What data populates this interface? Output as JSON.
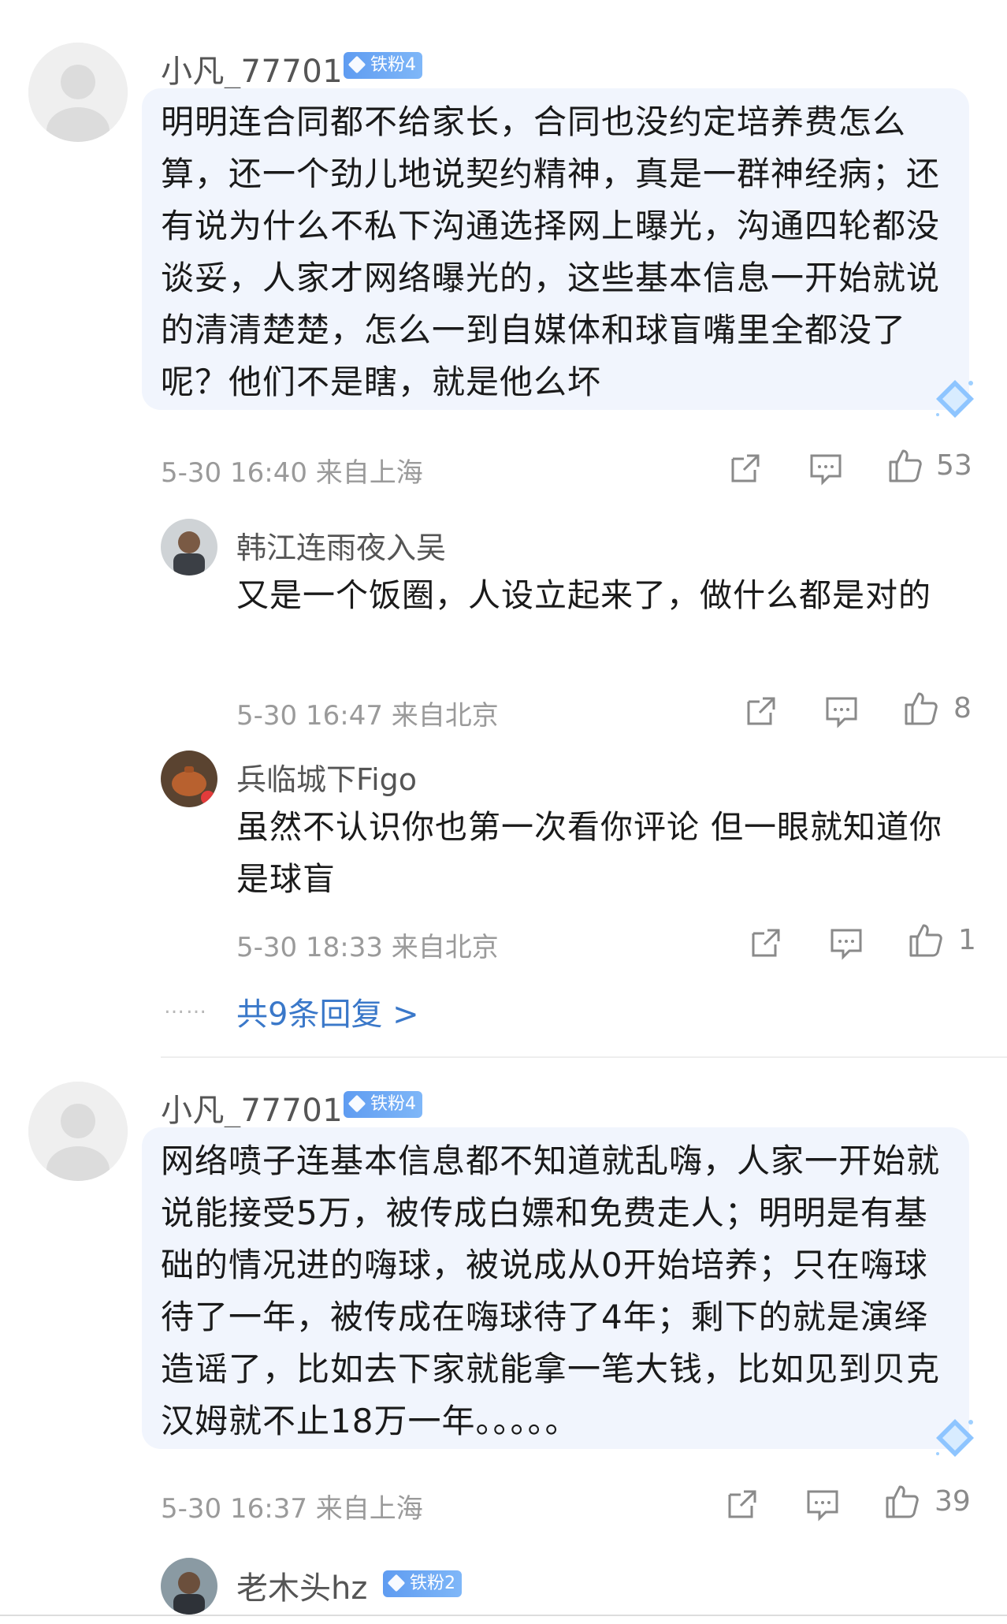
{
  "comments": [
    {
      "username": "小凡_77701",
      "badge": "铁粉4",
      "text": "明明连合同都不给家长，合同也没约定培养费怎么算，还一个劲儿地说契约精神，真是一群神经病；还有说为什么不私下沟通选择网上曝光，沟通四轮都没谈妥，人家才网络曝光的，这些基本信息一开始就说的清清楚楚，怎么一到自媒体和球盲嘴里全都没了呢？他们不是瞎，就是他么坏",
      "meta": "5-30 16:40 来自上海",
      "likes": "53",
      "replies": [
        {
          "username": "韩江连雨夜入吴",
          "text": "又是一个饭圈，人设立起来了，做什么都是对的",
          "meta": "5-30 16:47 来自北京",
          "likes": "8"
        },
        {
          "username": "兵临城下Figo",
          "text": "虽然不认识你也第一次看你评论 但一眼就知道你是球盲",
          "meta": "5-30 18:33 来自北京",
          "likes": "1"
        }
      ],
      "more_replies_dots": "……",
      "more_replies": "共9条回复 >"
    },
    {
      "username": "小凡_77701",
      "badge": "铁粉4",
      "text": "网络喷子连基本信息都不知道就乱嗨，人家一开始就说能接受5万，被传成白嫖和免费走人；明明是有基础的情况进的嗨球，被说成从0开始培养；只在嗨球待了一年，被传成在嗨球待了4年；剩下的就是演绎造谣了，比如去下家就能拿一笔大钱，比如见到贝克汉姆就不止18万一年。。。。。",
      "meta": "5-30 16:37 来自上海",
      "likes": "39"
    },
    {
      "username": "老木头hz",
      "badge": "铁粉2"
    }
  ],
  "colors": {
    "bubble": "#f1f5fd",
    "link": "#3a78c9",
    "badge": "#6aa7f4",
    "meta": "#9a9a9a"
  },
  "icons": [
    "share-icon",
    "comment-icon",
    "like-icon",
    "gem-icon"
  ]
}
